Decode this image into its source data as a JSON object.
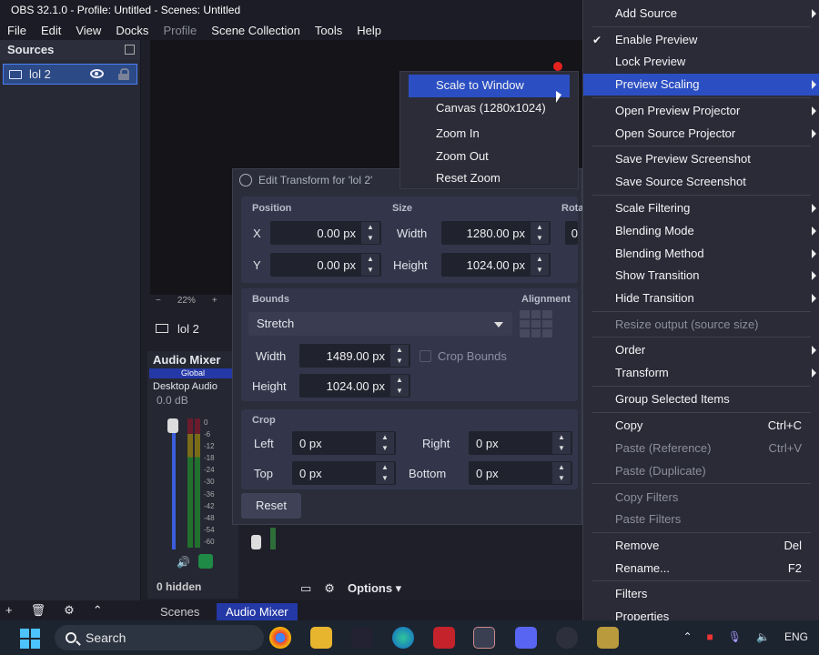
{
  "window": {
    "title": "OBS 32.1.0 - Profile: Untitled - Scenes: Untitled"
  },
  "menubar": [
    "File",
    "Edit",
    "View",
    "Docks",
    "Profile",
    "Scene Collection",
    "Tools",
    "Help"
  ],
  "sources": {
    "title": "Sources",
    "item": "lol 2"
  },
  "preview": {
    "zoom": "22%",
    "zoom_minus": "−",
    "zoom_plus": "+"
  },
  "scene": {
    "item": "lol 2"
  },
  "mixer": {
    "title": "Audio Mixer",
    "global": "Global",
    "channel": "Desktop Audio",
    "db": "0.0 dB",
    "ticks": [
      "0",
      "-6",
      "-12",
      "-18",
      "-24",
      "-30",
      "-36",
      "-42",
      "-48",
      "-54",
      "-60"
    ],
    "hidden": "0 hidden"
  },
  "bottom": {
    "options": "Options"
  },
  "docktabs": {
    "scenes": "Scenes",
    "audio_mixer": "Audio Mixer"
  },
  "transform": {
    "title": "Edit Transform for 'lol 2'",
    "position_label": "Position",
    "size_label": "Size",
    "rotation_label": "Rota",
    "x_label": "X",
    "x_value": "0.00 px",
    "y_label": "Y",
    "y_value": "0.00 px",
    "width_label": "Width",
    "width_value": "1280.00 px",
    "height_label": "Height",
    "height_value": "1024.00 px",
    "rotation_value": "0",
    "bounds_label": "Bounds",
    "alignment_label": "Alignment",
    "bounds_type": "Stretch",
    "bounds_width_label": "Width",
    "bounds_width_value": "1489.00 px",
    "bounds_height_label": "Height",
    "bounds_height_value": "1024.00 px",
    "crop_bounds": "Crop Bounds",
    "crop_label": "Crop",
    "left_label": "Left",
    "left_value": "0 px",
    "right_label": "Right",
    "right_value": "0 px",
    "top_label": "Top",
    "top_value": "0 px",
    "bottom_label": "Bottom",
    "bottom_value": "0 px",
    "reset": "Reset"
  },
  "scaling_submenu": [
    "Scale to Window",
    "Canvas (1280x1024)",
    "Zoom In",
    "Zoom Out",
    "Reset Zoom"
  ],
  "context_menu": [
    {
      "label": "Add Source",
      "submenu": true
    },
    {
      "label": "Enable Preview",
      "checked": true
    },
    {
      "label": "Lock Preview"
    },
    {
      "label": "Preview Scaling",
      "submenu": true,
      "highlighted": true
    },
    {
      "label": "Open Preview Projector",
      "submenu": true
    },
    {
      "label": "Open Source Projector",
      "submenu": true
    },
    {
      "label": "Save Preview Screenshot"
    },
    {
      "label": "Save Source Screenshot"
    },
    {
      "label": "Scale Filtering",
      "submenu": true
    },
    {
      "label": "Blending Mode",
      "submenu": true
    },
    {
      "label": "Blending Method",
      "submenu": true
    },
    {
      "label": "Show Transition",
      "submenu": true
    },
    {
      "label": "Hide Transition",
      "submenu": true
    },
    {
      "label": "Resize output (source size)",
      "disabled": true
    },
    {
      "label": "Order",
      "submenu": true
    },
    {
      "label": "Transform",
      "submenu": true
    },
    {
      "label": "Group Selected Items"
    },
    {
      "label": "Copy",
      "shortcut": "Ctrl+C"
    },
    {
      "label": "Paste (Reference)",
      "shortcut": "Ctrl+V",
      "disabled": true
    },
    {
      "label": "Paste (Duplicate)",
      "disabled": true
    },
    {
      "label": "Copy Filters",
      "disabled": true
    },
    {
      "label": "Paste Filters",
      "disabled": true
    },
    {
      "label": "Remove",
      "shortcut": "Del"
    },
    {
      "label": "Rename...",
      "shortcut": "F2"
    },
    {
      "label": "Filters"
    },
    {
      "label": "Properties"
    }
  ],
  "taskbar": {
    "search": "Search",
    "lang": "ENG"
  },
  "colors": {
    "accent": "#2b4fc3",
    "bg": "#1e1f29",
    "menu_bg": "#2a2b37"
  }
}
